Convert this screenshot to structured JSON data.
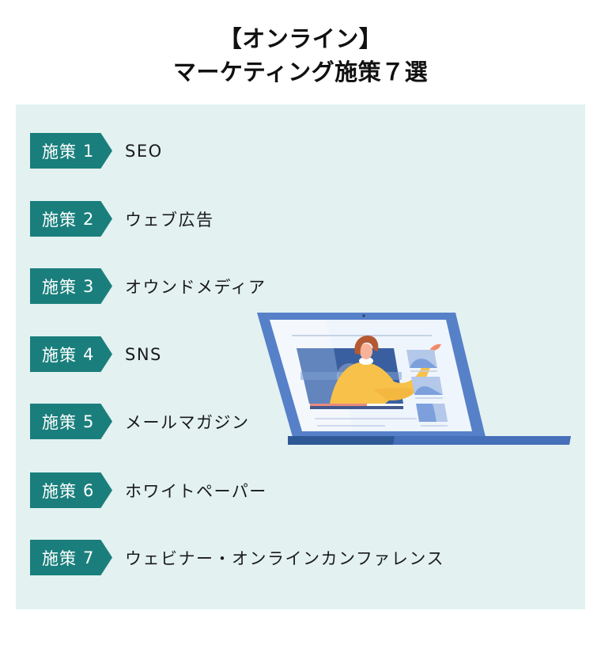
{
  "title": {
    "line1": "【オンライン】",
    "line2": "マーケティング施策７選"
  },
  "colors": {
    "badge": "#1a7f7c",
    "panel_background": "#e3f1f1",
    "laptop_frame": "#5680c8",
    "laptop_base_dark": "#2f5896",
    "screen": "#eef5fc",
    "sweater": "#f7c14a"
  },
  "items": [
    {
      "badge_prefix": "施策",
      "number": "1",
      "label": "SEO"
    },
    {
      "badge_prefix": "施策",
      "number": "2",
      "label": "ウェブ広告"
    },
    {
      "badge_prefix": "施策",
      "number": "3",
      "label": "オウンドメディア"
    },
    {
      "badge_prefix": "施策",
      "number": "4",
      "label": "SNS"
    },
    {
      "badge_prefix": "施策",
      "number": "5",
      "label": "メールマガジン"
    },
    {
      "badge_prefix": "施策",
      "number": "6",
      "label": "ホワイトペーパー"
    },
    {
      "badge_prefix": "施策",
      "number": "7",
      "label": "ウェビナー・オンラインカンファレンス"
    }
  ],
  "illustration": {
    "icon": "laptop-webinar-icon",
    "description": "laptop showing a presenter in a video player"
  }
}
